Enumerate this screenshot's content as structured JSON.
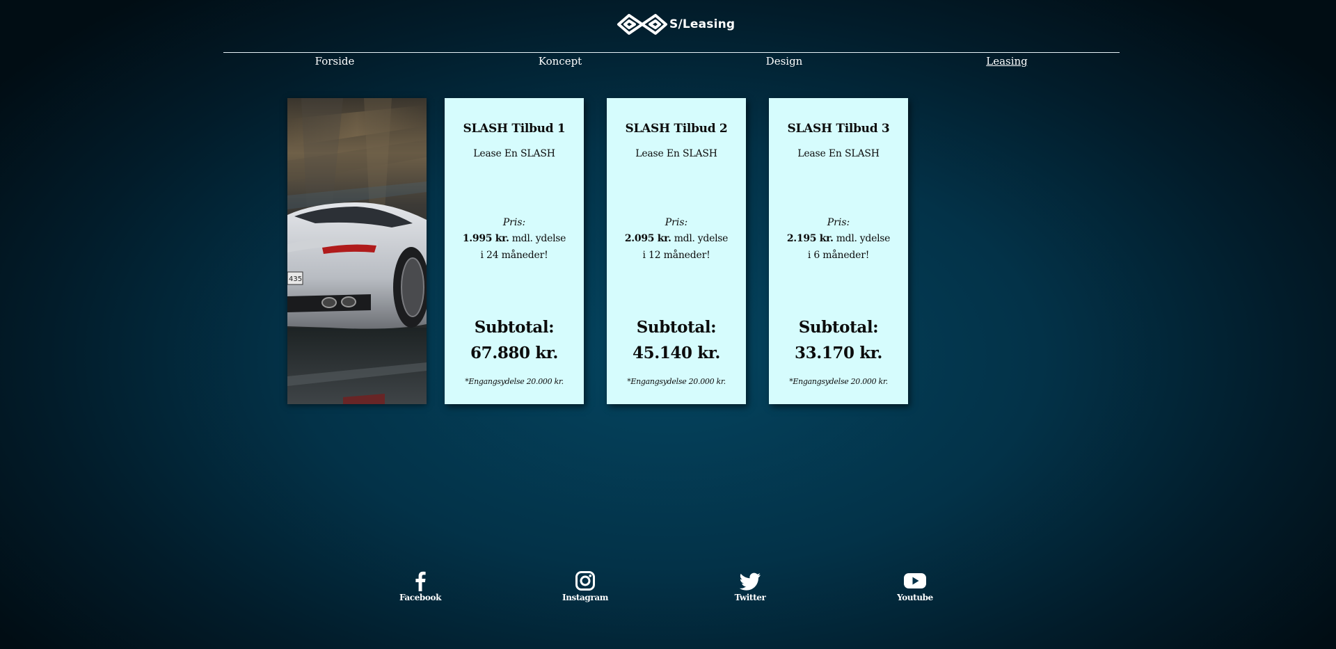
{
  "header": {
    "logo_text": "S/Leasing"
  },
  "nav": {
    "items": [
      {
        "label": "Forside",
        "active": false
      },
      {
        "label": "Koncept",
        "active": false
      },
      {
        "label": "Design",
        "active": false
      },
      {
        "label": "Leasing",
        "active": true
      }
    ]
  },
  "offers": [
    {
      "title": "SLASH Tilbud 1",
      "subtitle": "Lease En SLASH",
      "price_label": "Pris:",
      "price_amount": "1.995 kr.",
      "price_suffix": " mdl. ydelse",
      "duration": "i 24 måneder!",
      "subtotal_label": "Subtotal:",
      "subtotal_value": "67.880 kr.",
      "note": "*Engangsydelse 20.000 kr."
    },
    {
      "title": "SLASH Tilbud 2",
      "subtitle": "Lease En SLASH",
      "price_label": "Pris:",
      "price_amount": "2.095 kr.",
      "price_suffix": " mdl. ydelse",
      "duration": "i 12 måneder!",
      "subtotal_label": "Subtotal:",
      "subtotal_value": "45.140 kr.",
      "note": "*Engangsydelse 20.000 kr."
    },
    {
      "title": "SLASH Tilbud 3",
      "subtitle": "Lease En SLASH",
      "price_label": "Pris:",
      "price_amount": "2.195 kr.",
      "price_suffix": " mdl. ydelse",
      "duration": "i 6 måneder!",
      "subtotal_label": "Subtotal:",
      "subtotal_value": "33.170 kr.",
      "note": "*Engangsydelse 20.000 kr."
    }
  ],
  "footer": {
    "social": [
      {
        "label": "Facebook",
        "icon": "facebook-icon"
      },
      {
        "label": "Instagram",
        "icon": "instagram-icon"
      },
      {
        "label": "Twitter",
        "icon": "twitter-icon"
      },
      {
        "label": "Youtube",
        "icon": "youtube-icon"
      }
    ]
  },
  "colors": {
    "background_center": "#04445f",
    "background_edge": "#010d14",
    "card_background": "#d6fcfd",
    "text_light": "#ffffff",
    "text_dark": "#0c0c0c"
  }
}
